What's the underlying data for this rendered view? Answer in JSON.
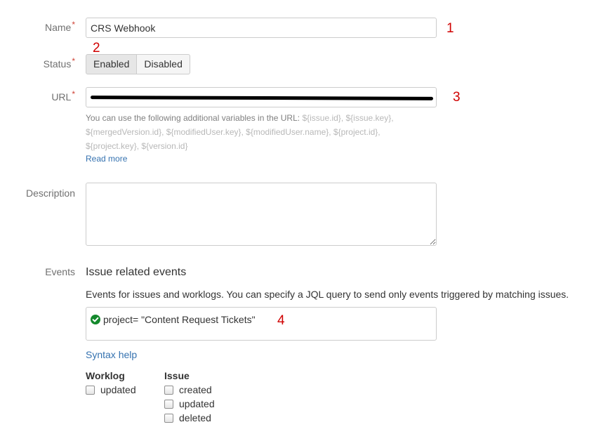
{
  "form": {
    "name": {
      "label": "Name",
      "required": "*",
      "value": "CRS Webhook",
      "annotation": "1"
    },
    "status": {
      "label": "Status",
      "required": "*",
      "annotation": "2",
      "options": [
        "Enabled",
        "Disabled"
      ],
      "selected": "Enabled"
    },
    "url": {
      "label": "URL",
      "required": "*",
      "annotation": "3",
      "help_prefix": "You can use the following additional variables in the URL:",
      "variables": [
        "${issue.id},",
        "${issue.key},",
        "${mergedVersion.id},",
        "${modifiedUser.key},",
        "${modifiedUser.name},",
        "${project.id},",
        "${project.key},",
        "${version.id}"
      ],
      "read_more": "Read more"
    },
    "description": {
      "label": "Description",
      "value": ""
    },
    "events": {
      "label": "Events",
      "heading": "Issue related events",
      "subtext": "Events for issues and worklogs. You can specify a JQL query to send only events triggered by matching issues.",
      "jql": "project= \"Content Request Tickets\"",
      "annotation": "4",
      "syntax_help": "Syntax help",
      "worklog": {
        "title": "Worklog",
        "items": [
          "updated"
        ]
      },
      "issue": {
        "title": "Issue",
        "items": [
          "created",
          "updated",
          "deleted"
        ]
      }
    }
  },
  "colors": {
    "required": "#d04437",
    "annotation": "#d00000",
    "link": "#3572b0",
    "valid": "#14892c"
  }
}
